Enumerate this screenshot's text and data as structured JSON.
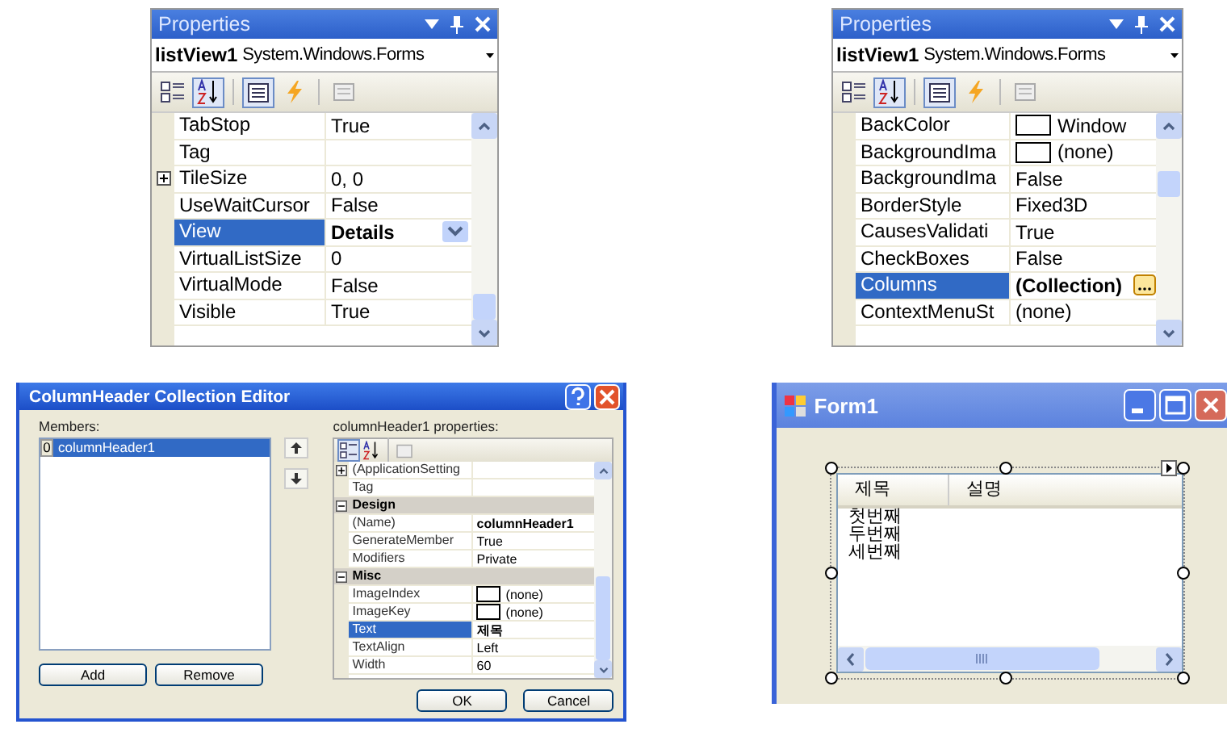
{
  "properties_left": {
    "title": "Properties",
    "object_name": "listView1",
    "object_type": "System.Windows.Forms",
    "toolbar": [
      {
        "kind": "categorized",
        "selected": false
      },
      {
        "kind": "alphabetical",
        "selected": true
      },
      {
        "kind": "properties",
        "selected": true
      },
      {
        "kind": "events",
        "selected": false
      },
      {
        "kind": "pages",
        "selected": false
      }
    ],
    "rows": [
      {
        "name": "TabStop",
        "value": "True",
        "selected": false
      },
      {
        "name": "Tag",
        "value": "",
        "selected": false
      },
      {
        "name": "TileSize",
        "value": "0, 0",
        "selected": false,
        "expandable": true
      },
      {
        "name": "UseWaitCursor",
        "value": "False",
        "selected": false
      },
      {
        "name": "View",
        "value": "Details",
        "selected": true,
        "bold": true,
        "dropdown": true
      },
      {
        "name": "VirtualListSize",
        "value": "0",
        "selected": false
      },
      {
        "name": "VirtualMode",
        "value": "False",
        "selected": false
      },
      {
        "name": "Visible",
        "value": "True",
        "selected": false
      }
    ]
  },
  "properties_right": {
    "title": "Properties",
    "object_name": "listView1",
    "object_type": "System.Windows.Forms",
    "toolbar": [
      {
        "kind": "categorized",
        "selected": false
      },
      {
        "kind": "alphabetical",
        "selected": true
      },
      {
        "kind": "properties",
        "selected": true
      },
      {
        "kind": "events",
        "selected": false
      },
      {
        "kind": "pages",
        "selected": false
      }
    ],
    "rows": [
      {
        "name": "BackColor",
        "value": "Window",
        "selected": false,
        "swatch": true
      },
      {
        "name": "BackgroundIma",
        "value": "(none)",
        "selected": false,
        "swatch": true
      },
      {
        "name": "BackgroundIma",
        "value": "False",
        "selected": false
      },
      {
        "name": "BorderStyle",
        "value": "Fixed3D",
        "selected": false
      },
      {
        "name": "CausesValidati",
        "value": "True",
        "selected": false
      },
      {
        "name": "CheckBoxes",
        "value": "False",
        "selected": false
      },
      {
        "name": "Columns",
        "value": "(Collection)",
        "selected": true,
        "bold": true,
        "ellipsis": true
      },
      {
        "name": "ContextMenuSt",
        "value": "(none)",
        "selected": false
      }
    ]
  },
  "collection_editor": {
    "title": "ColumnHeader Collection Editor",
    "members_label": "Members:",
    "members": [
      {
        "index": "0",
        "name": "columnHeader1",
        "selected": true
      }
    ],
    "properties_label": "columnHeader1 properties:",
    "rows": [
      {
        "kind": "property",
        "name": "(ApplicationSetting",
        "value": "",
        "expandable": true,
        "selected": false
      },
      {
        "kind": "property",
        "name": "Tag",
        "value": "",
        "selected": false
      },
      {
        "kind": "category",
        "name": "Design",
        "expanded": true
      },
      {
        "kind": "property",
        "name": "(Name)",
        "value": "columnHeader1",
        "bold": true,
        "selected": false
      },
      {
        "kind": "property",
        "name": "GenerateMember",
        "value": "True",
        "selected": false
      },
      {
        "kind": "property",
        "name": "Modifiers",
        "value": "Private",
        "selected": false
      },
      {
        "kind": "category",
        "name": "Misc",
        "expanded": true
      },
      {
        "kind": "property",
        "name": "ImageIndex",
        "value": "(none)",
        "swatch": true,
        "selected": false
      },
      {
        "kind": "property",
        "name": "ImageKey",
        "value": "(none)",
        "swatch": true,
        "selected": false
      },
      {
        "kind": "property",
        "name": "Text",
        "value": "제목",
        "bold": true,
        "selected": true
      },
      {
        "kind": "property",
        "name": "TextAlign",
        "value": "Left",
        "selected": false
      },
      {
        "kind": "property",
        "name": "Width",
        "value": "60",
        "selected": false
      }
    ],
    "buttons": {
      "add": "Add",
      "remove": "Remove",
      "ok": "OK",
      "cancel": "Cancel"
    }
  },
  "form_window": {
    "title": "Form1",
    "columns": [
      "제목",
      "설명"
    ],
    "items": [
      "첫번째",
      "두번째",
      "세번째"
    ]
  }
}
